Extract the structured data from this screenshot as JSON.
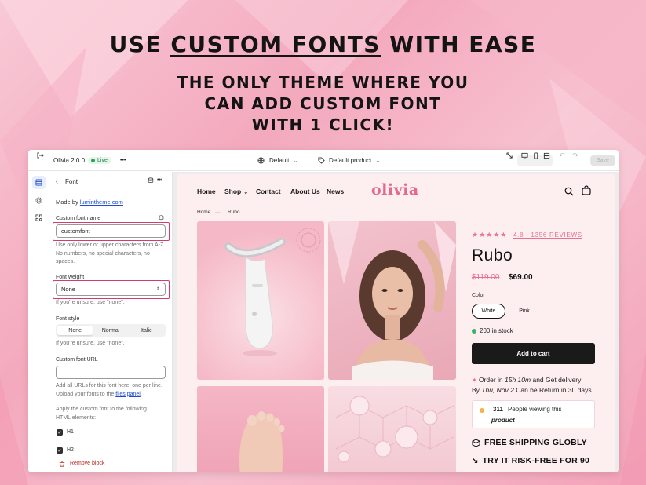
{
  "headline": {
    "title_pre": "Use ",
    "title_underlined": "custom fonts",
    "title_post": " with ease",
    "subtitle_lines": [
      "The only theme where you",
      "can add custom font",
      "with 1 click!"
    ]
  },
  "editor": {
    "app_name": "Olivia 2.0.0",
    "status_badge": "Live",
    "more_label": "•••",
    "theme_selector": "Default",
    "template_selector": "Default product",
    "save_label": "Save"
  },
  "panel": {
    "back_title": "Font",
    "more_label": "•••",
    "made_by_prefix": "Made by ",
    "made_by_link": "lumintheme.com",
    "custom_font_name_label": "Custom font name",
    "custom_font_name_value": "customfont",
    "custom_font_name_hint": "Use only lower or upper characters from A-Z. No numbers, no special characters, no spaces.",
    "font_weight_label": "Font weight",
    "font_weight_value": "None",
    "font_weight_hint": "If you're unsure, use \"none\".",
    "font_style_label": "Font style",
    "font_style_options": [
      "None",
      "Normal",
      "Italic"
    ],
    "font_style_selected": "None",
    "font_style_hint": "If you're unsure, use \"none\".",
    "font_url_label": "Custom font URL",
    "font_url_value": "",
    "font_url_hint_1": "Add all URLs for this font here, one per line. Upload your fonts to the ",
    "font_url_hint_link": "files panel",
    "font_url_hint_2": ".",
    "apply_hint": "Apply the custom font to the following HTML elements:",
    "checkbox_h1": "H1",
    "checkbox_h2": "H2",
    "remove_block": "Remove block"
  },
  "store": {
    "nav": [
      "Home",
      "Shop",
      "Contact",
      "About Us",
      "News"
    ],
    "logo": "olivia",
    "breadcrumb": [
      "Home",
      "Rubo"
    ],
    "stars": "★★★★★",
    "rating_text": "4.8 - 1356 REVIEWS",
    "product_title": "Rubo",
    "old_price": "$119.00",
    "price": "$69.00",
    "color_label": "Color",
    "colors": [
      "White",
      "Pink"
    ],
    "selected_color": "White",
    "stock_text": "200 in stock",
    "add_to_cart": "Add to cart",
    "delivery_line1_a": "Order in ",
    "delivery_line1_b": "15h 10m",
    "delivery_line1_c": " and Get delivery",
    "delivery_line2_a": "By ",
    "delivery_line2_b": "Thu, Nov 2",
    "delivery_line2_c": " Can be Return in 30 days.",
    "viewers_count": "311",
    "viewers_text": "People viewing this",
    "viewers_item": "product",
    "feature_1": "FREE SHIPPING GLOBLY",
    "feature_2": "TRY IT RISK-FREE FOR 90",
    "accent_color": "#e8718f",
    "highlight_color": "#d53a72"
  }
}
